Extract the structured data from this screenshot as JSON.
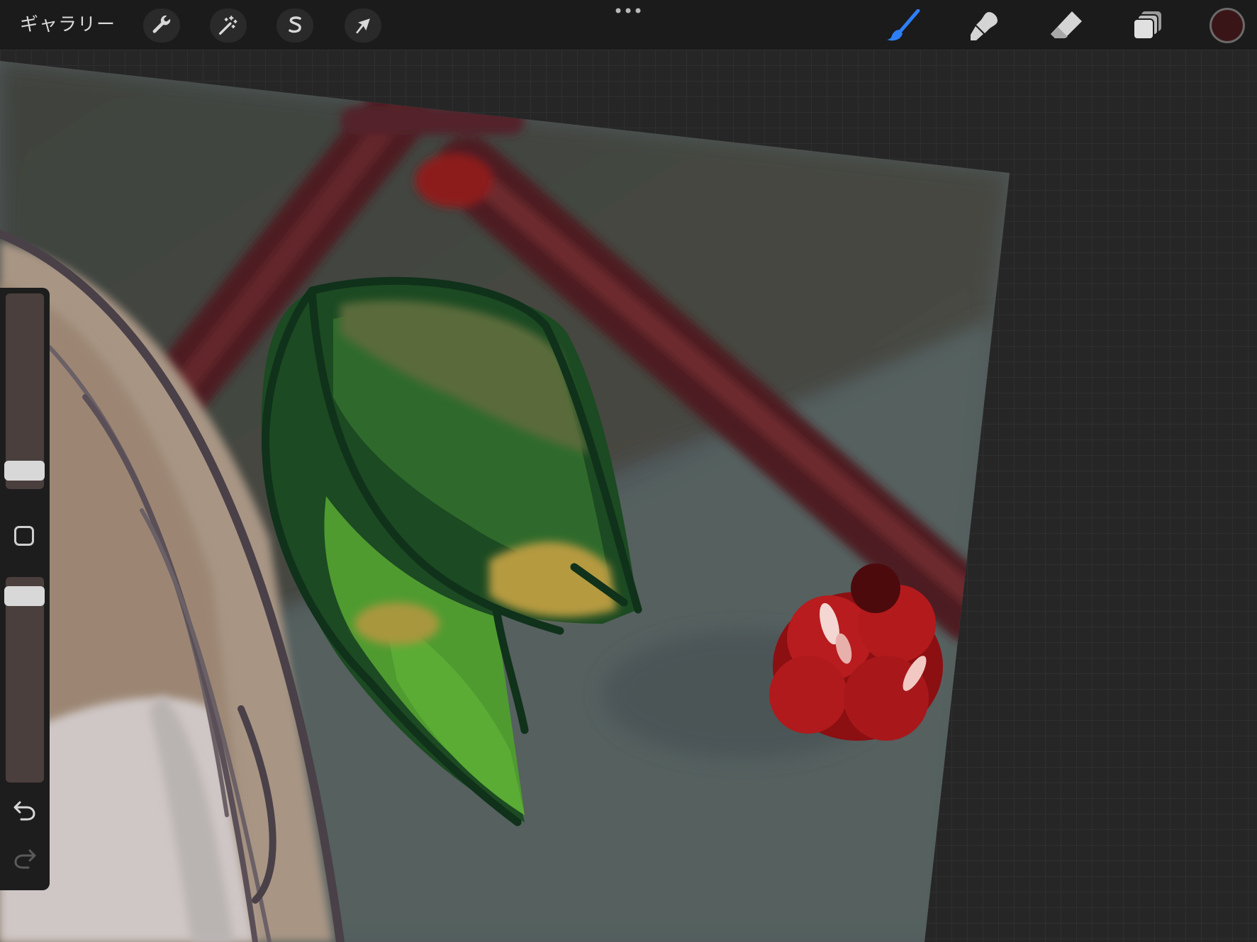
{
  "topbar": {
    "gallery_label": "ギャラリー",
    "left_tools": [
      {
        "icon": "wrench-icon",
        "name": "actions"
      },
      {
        "icon": "magic-wand-icon",
        "name": "adjustments"
      },
      {
        "icon": "selection-s-icon",
        "name": "selection"
      },
      {
        "icon": "arrow-cursor-icon",
        "name": "transform"
      }
    ],
    "more_icon": "ellipsis-icon",
    "right_tools": [
      {
        "icon": "brush-icon",
        "name": "paint",
        "active": true
      },
      {
        "icon": "smudge-icon",
        "name": "smudge"
      },
      {
        "icon": "eraser-icon",
        "name": "erase"
      },
      {
        "icon": "layers-icon",
        "name": "layers"
      }
    ],
    "current_color": "#3a1518"
  },
  "sidebar": {
    "brush_size_level": 0.05,
    "opacity_level": 0.95,
    "modify_icon": "square-icon",
    "undo_icon": "undo-icon",
    "redo_icon": "redo-icon"
  },
  "colors": {
    "accent": "#2d7ff9",
    "background": "#262626",
    "toolbar": "#1b1b1b"
  }
}
